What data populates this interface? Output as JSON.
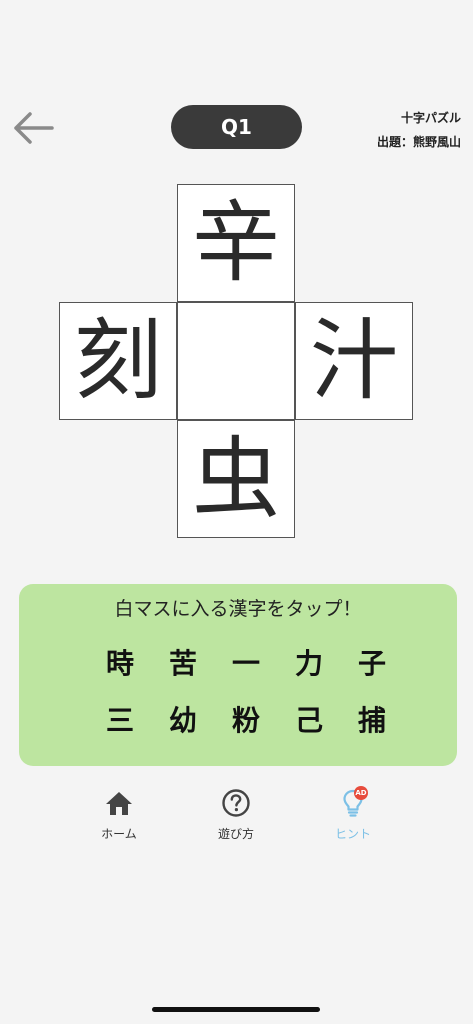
{
  "header": {
    "question_label": "Q1",
    "puzzle_type": "十字パズル",
    "author": "出題：熊野風山"
  },
  "puzzle": {
    "top": "辛",
    "left": "刻",
    "center": "",
    "right": "汁",
    "bottom": "虫"
  },
  "choices": {
    "instruction": "白マスに入る漢字をタップ！",
    "row1": [
      "時",
      "苦",
      "一",
      "力",
      "子"
    ],
    "row2": [
      "三",
      "幼",
      "粉",
      "己",
      "捕"
    ]
  },
  "tabbar": {
    "home": {
      "label": "ホーム",
      "icon": "home-icon"
    },
    "howto": {
      "label": "遊び方",
      "icon": "question-circle-icon"
    },
    "hint": {
      "label": "ヒント",
      "icon": "lightbulb-icon",
      "badge": "AD"
    }
  },
  "colors": {
    "background": "#f4f4f4",
    "pill": "#3a3a3a",
    "panel": "#bde5a0",
    "hint_accent": "#7cc0e6",
    "badge": "#e74c3c"
  }
}
